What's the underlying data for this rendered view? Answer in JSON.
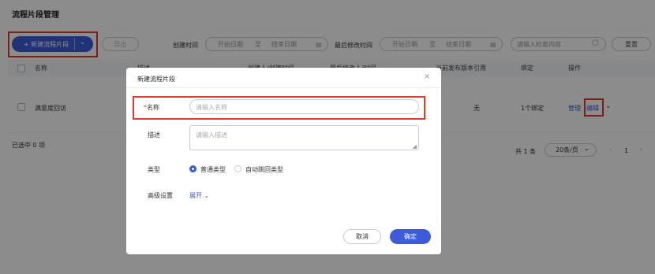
{
  "page": {
    "title": "流程片段管理"
  },
  "toolbar": {
    "new_button_label": "+ 新建流程片段",
    "export_label": "导出",
    "created_time_label": "创建时间",
    "start_date_placeholder": "开始日期",
    "range_separator": "至",
    "end_date_placeholder": "结束日期",
    "modified_time_label": "最后修改时间",
    "search_placeholder": "请输入检索内容",
    "reset_label": "重置"
  },
  "table": {
    "columns": [
      "名称",
      "描述",
      "创建人/创建时间",
      "最后修改人/时间",
      "当前发布版本",
      "引用",
      "绑定",
      "操作"
    ],
    "rows": [
      {
        "name": "满意度回访",
        "reference": "无",
        "binding": "1个绑定",
        "manage_label": "管理",
        "edit_label": "编辑"
      }
    ]
  },
  "footer": {
    "selected_text": "已选中 0 项",
    "total_text": "共 1 条",
    "page_size": "20条/页",
    "current_page": "1"
  },
  "modal": {
    "title": "新建流程片段",
    "required_mark": "*",
    "name_label": "名称",
    "name_placeholder": "请输入名称",
    "desc_label": "描述",
    "desc_placeholder": "请输入描述",
    "type_label": "类型",
    "type_option_normal": "普通类型",
    "type_option_auto": "自动跳回类型",
    "advanced_label": "高级设置",
    "expand_label": "展开",
    "cancel_label": "取消",
    "confirm_label": "确定"
  },
  "colors": {
    "primary": "#3b5bdb",
    "highlight": "#e03b2e"
  }
}
